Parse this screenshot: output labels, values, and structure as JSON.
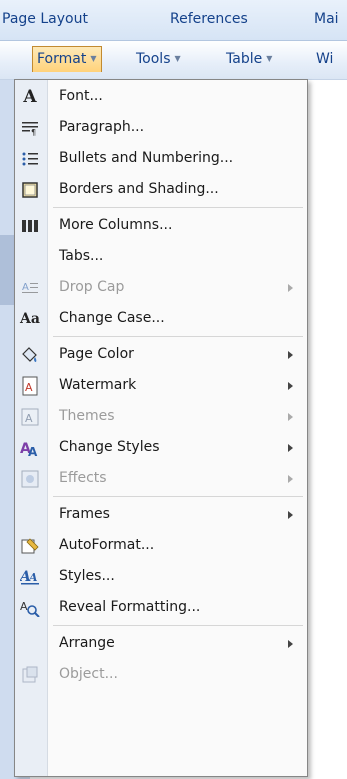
{
  "ribbon_tabs": [
    "Page Layout",
    "References",
    "Mai"
  ],
  "menubar": {
    "format": "Format",
    "tools": "Tools",
    "table": "Table",
    "partial": "Wi"
  },
  "menu": {
    "font": "Font...",
    "paragraph": "Paragraph...",
    "bullets": "Bullets and Numbering...",
    "borders": "Borders and Shading...",
    "columns": "More Columns...",
    "tabs": "Tabs...",
    "drop_cap": "Drop Cap",
    "change_case": "Change Case...",
    "page_color": "Page Color",
    "watermark": "Watermark",
    "themes": "Themes",
    "change_styles": "Change Styles",
    "effects": "Effects",
    "frames": "Frames",
    "autoformat": "AutoFormat...",
    "styles": "Styles...",
    "reveal": "Reveal Formatting...",
    "arrange": "Arrange",
    "object": "Object..."
  },
  "icon_texts": {
    "font": "A",
    "change_case": "Aa"
  },
  "colors": {
    "accent": "#15428b",
    "active_menu": "#ffd27a",
    "disabled": "#9b9b9b"
  }
}
